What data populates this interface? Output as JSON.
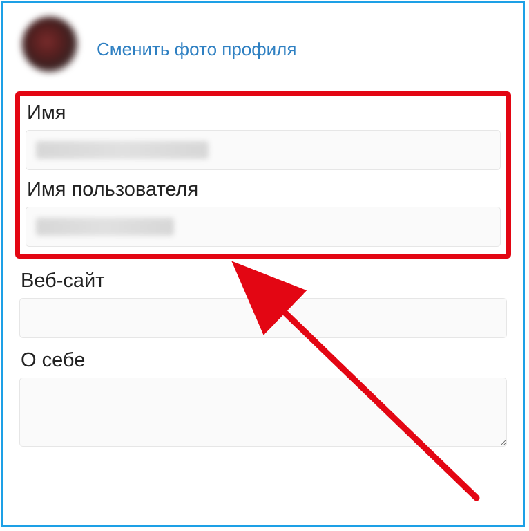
{
  "header": {
    "change_photo_label": "Сменить фото профиля"
  },
  "fields": {
    "name": {
      "label": "Имя",
      "value": ""
    },
    "username": {
      "label": "Имя пользователя",
      "value": ""
    },
    "website": {
      "label": "Веб-сайт",
      "value": ""
    },
    "bio": {
      "label": "О себе",
      "value": ""
    }
  },
  "colors": {
    "link": "#2f80c2",
    "highlight": "#e30613",
    "frame": "#1da0e6"
  }
}
